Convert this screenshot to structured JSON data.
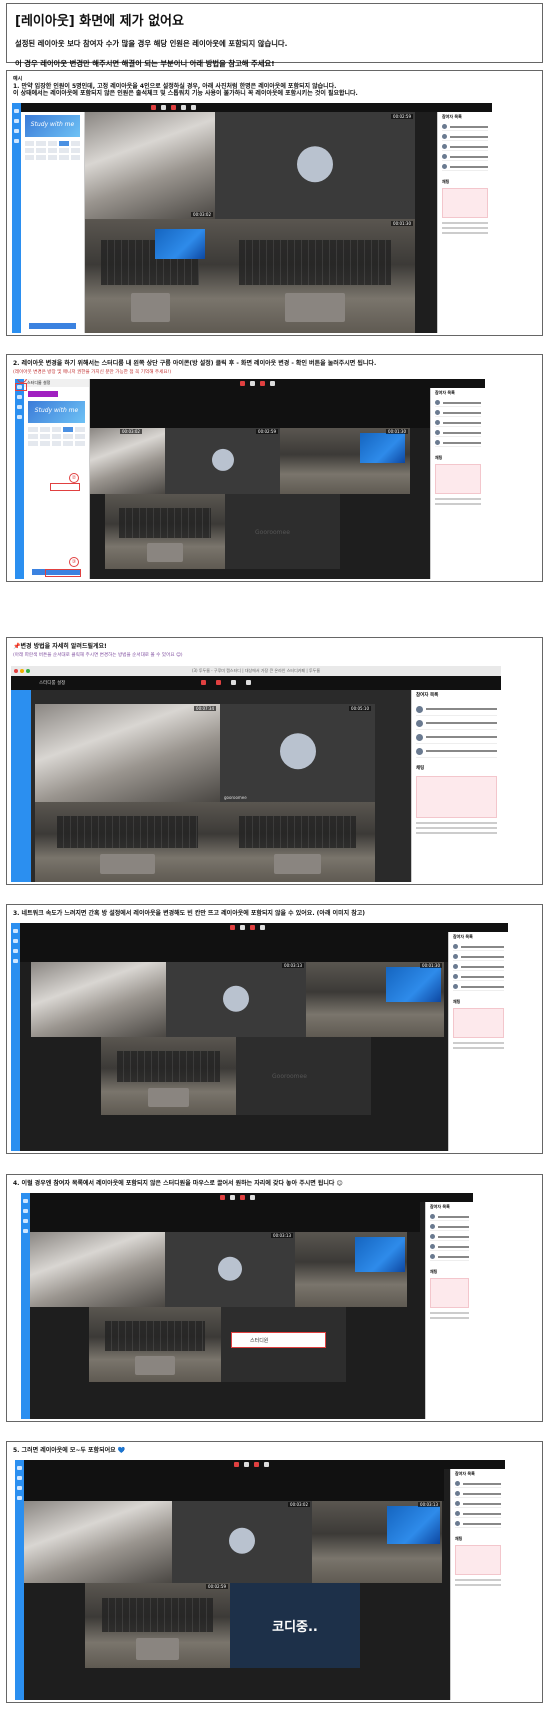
{
  "header": {
    "title": "[레이아웃] 화면에 제가 없어요",
    "line1": "설정된 레이아웃 보다 참여자 수가 많을 경우 해당 인원은 레이아웃에 포함되지 않습니다.",
    "line2": "이 경우 레이아웃 변경만 해주시면 해결이 되는 부분이니 아래 방법을 참고해 주세요!"
  },
  "section1": {
    "tag": "예시",
    "text1": "1. 만약 입장한 인원이 5명인데, 고정 레이아웃을 4인으로 설정하실 경우, 아래 사진처럼 한명은 레이아웃에 포함되지 않습니다.",
    "text2": "이 상태에서는 레이아웃에 포함되지 않은 인원은 출석체크 및 스톱워치 기능 사용이 불가하니 꼭 레이아웃에 포함시키는 것이 필요합니다."
  },
  "section2": {
    "text": "2. 레이아웃 변경을 하기 위해서는 스터디룸 내 왼쪽 상단 구름 아이콘(방 설정) 클릭 후 - 화면 레이아웃 변경 - 확인 버튼을 눌러주시면 됩니다.",
    "note": "(레이아웃 변경은 방장 및 매니저 권한을 가지신 분만 가능한 점 꼭 기억해 주세요!)",
    "marker1": "①",
    "marker2": "②",
    "marker3": "③"
  },
  "section3": {
    "text": "📌변경 방법을 자세히 알려드릴게요!",
    "note": "(아래 파란색 버튼을 순서대로 클릭해 주시면 변경하는 방법을 순서대로 볼 수 있어요 😊)",
    "url_bar": "(3) 투두룸 - 구루미 캠스터디 | 대상에서 가장 큰 온라인 스터디카페 | 투두룸",
    "room_name": "스터디룸 설정"
  },
  "section4": {
    "text": "3. 네트워크 속도가 느려지면 간혹 방 설정에서 레이아웃을 변경해도 빈 칸만 뜨고 레이아웃에 포함되지 않을 수 있어요. (아래 이미지 참고)"
  },
  "section5": {
    "text": "4. 이럴 경우엔 참여자 목록에서 레이아웃에 포함되지 않은 스터디원을 마우스로 끌어서 원하는 자리에 갖다 놓아 주시면 됩니다 😊",
    "drag_label": "스터디원"
  },
  "section6": {
    "text": "5. 그러면 레이아웃에 모~두 포함되어요 💙",
    "code_label": "코디중.."
  },
  "shot_labels": {
    "timer_a": "00:02:59",
    "timer_b": "00:03:02",
    "timer_c": "00:01:30",
    "timer_d": "00:07:34",
    "timer_e": "00:05:10",
    "timer_f": "00:03:13",
    "panel_title": "참여자 목록",
    "chat_title": "채팅",
    "brand": "Gooroomee",
    "banner": "Study with me",
    "cam_name": "gooroomee"
  },
  "colors": {
    "accent": "#2b8ff0",
    "danger": "#e04040",
    "chat_bg": "#fde9ec"
  }
}
